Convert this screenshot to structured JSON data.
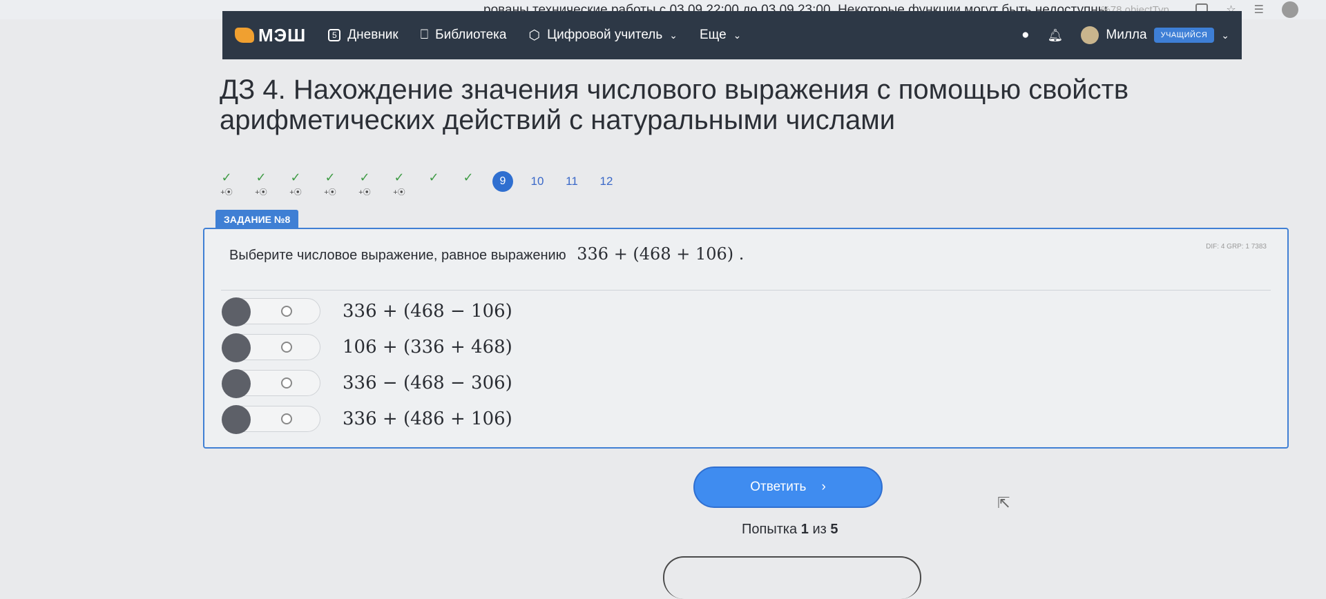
{
  "browser": {
    "notice": "рованы технические работы с 03.09 22:00 до 03.09 23:00. Некоторые функции могут быть недоступны.",
    "tab_text": "...%78 objectTyp..."
  },
  "nav": {
    "logo": "МЭШ",
    "items": [
      {
        "label": "Дневник",
        "icon": "diary-icon"
      },
      {
        "label": "Библиотека",
        "icon": "bookmark-icon"
      },
      {
        "label": "Цифровой учитель",
        "icon": "cube-icon"
      },
      {
        "label": "Еще",
        "icon": "chevron-down-icon"
      }
    ],
    "user_name": "Милла",
    "role": "УЧАЩИЙСЯ"
  },
  "page": {
    "title": "ДЗ 4. Нахождение значения числового выражения с помощью свойств арифметических действий с натуральными числами"
  },
  "steps": {
    "completed_marker": "+⦿",
    "items": [
      "9",
      "10",
      "11",
      "12"
    ]
  },
  "task": {
    "badge": "ЗАДАНИЕ №8",
    "meta": "DIF: 4   GRP: 1   7383",
    "question": "Выберите числовое выражение, равное выражению",
    "expression": "336 + (468 + 106) .",
    "options": [
      "336 + (468 − 106)",
      "106 + (336 + 468)",
      "336 − (468 − 306)",
      "336 + (486 + 106)"
    ]
  },
  "actions": {
    "answer_label": "Ответить",
    "attempt_prefix": "Попытка",
    "attempt_current": "1",
    "attempt_mid": "из",
    "attempt_total": "5"
  }
}
